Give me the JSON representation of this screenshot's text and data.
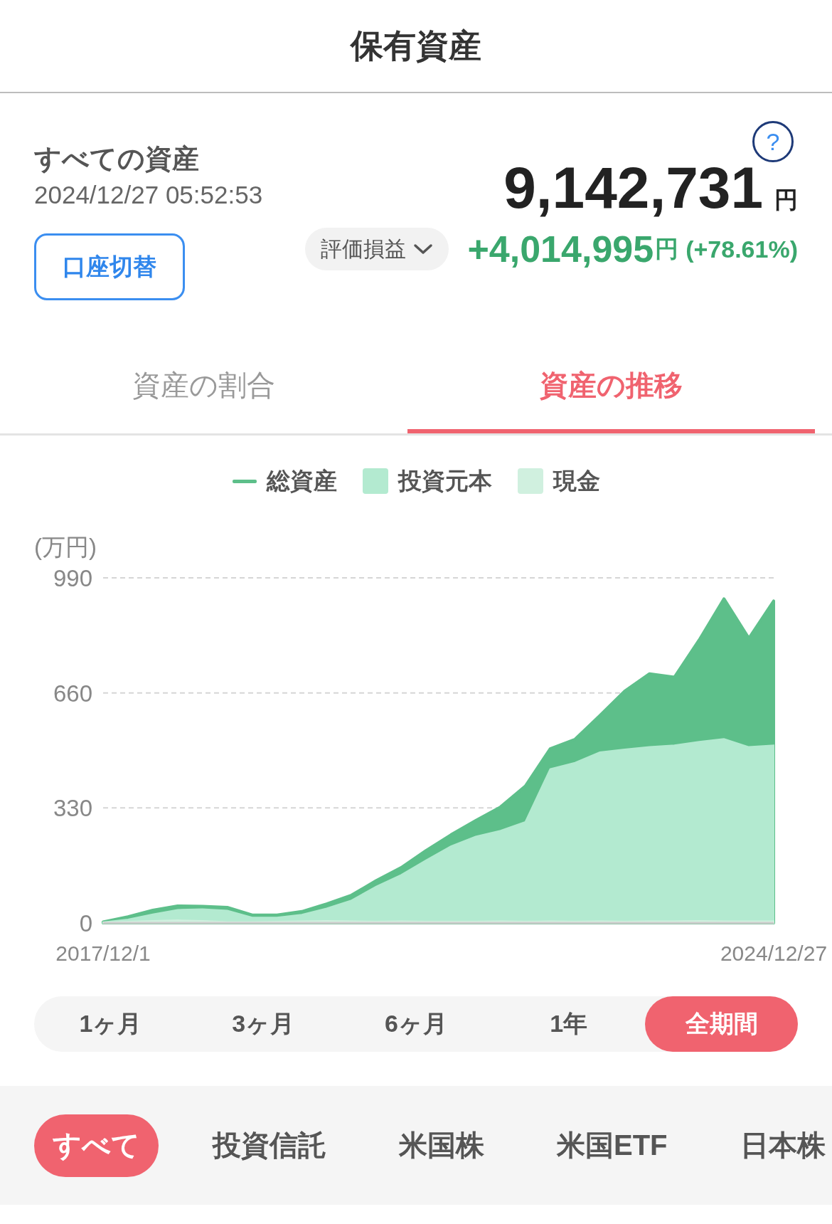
{
  "header": {
    "title": "保有資産"
  },
  "summary": {
    "title": "すべての資産",
    "timestamp": "2024/12/27 05:52:53",
    "help_icon": "?",
    "switch_button": "口座切替",
    "mode_selector": {
      "label": "評価損益"
    },
    "total": {
      "value": "9,142,731",
      "unit": "円"
    },
    "gain": {
      "value": "+4,014,995",
      "unit": "円",
      "percent": "(+78.61%)"
    }
  },
  "tabs": [
    {
      "label": "資産の割合",
      "selected": false
    },
    {
      "label": "資産の推移",
      "selected": true
    }
  ],
  "chart": {
    "chart_data": {
      "type": "area",
      "ylabel": "(万円)",
      "categories": [
        "2017/12/1",
        null,
        null,
        null,
        null,
        null,
        null,
        null,
        null,
        null,
        null,
        null,
        null,
        null,
        null,
        null,
        null,
        null,
        null,
        null,
        null,
        null,
        null,
        null,
        null,
        null,
        null,
        "2024/12/27"
      ],
      "ylim": [
        0,
        990
      ],
      "yticks": [
        0,
        330,
        660,
        990
      ],
      "series": [
        {
          "name": "総資産",
          "color": "#5dbf8a",
          "values": [
            3,
            18,
            37,
            49,
            48,
            45,
            23,
            23,
            33,
            55,
            80,
            122,
            159,
            208,
            253,
            294,
            333,
            393,
            500,
            527,
            595,
            665,
            715,
            705,
            812,
            930,
            817,
            924
          ]
        },
        {
          "name": "投資元本",
          "color": "#b3ead0",
          "values": [
            2,
            10,
            25,
            38,
            40,
            36,
            16,
            16,
            24,
            42,
            65,
            105,
            138,
            180,
            220,
            248,
            265,
            290,
            442,
            460,
            490,
            498,
            505,
            510,
            520,
            528,
            505,
            510
          ]
        },
        {
          "name": "現金",
          "color": "#d0f0df",
          "values": [
            2,
            4,
            6,
            8,
            6,
            3,
            3,
            4,
            5,
            6,
            5,
            4,
            5,
            4,
            4,
            4,
            5,
            4,
            5,
            4,
            5,
            4,
            5,
            5,
            6,
            5,
            5,
            5
          ]
        }
      ]
    }
  },
  "periods": [
    {
      "label": "1ヶ月",
      "selected": false
    },
    {
      "label": "3ヶ月",
      "selected": false
    },
    {
      "label": "6ヶ月",
      "selected": false
    },
    {
      "label": "1年",
      "selected": false
    },
    {
      "label": "全期間",
      "selected": true
    }
  ],
  "categories": [
    {
      "label": "すべて",
      "selected": true
    },
    {
      "label": "投資信託",
      "selected": false
    },
    {
      "label": "米国株",
      "selected": false
    },
    {
      "label": "米国ETF",
      "selected": false
    },
    {
      "label": "日本株",
      "selected": false
    }
  ]
}
